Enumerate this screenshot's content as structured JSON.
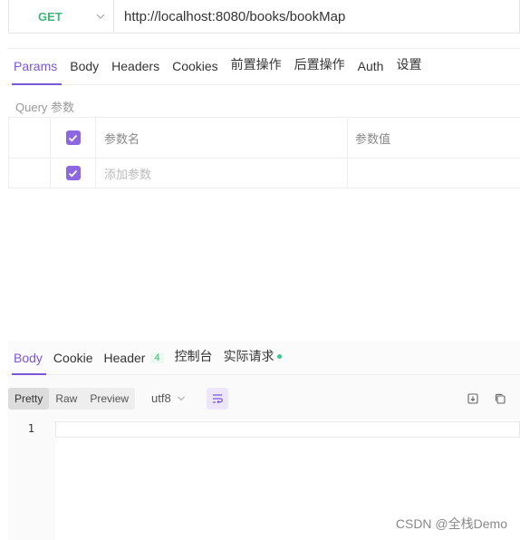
{
  "request": {
    "method": "GET",
    "url": "http://localhost:8080/books/bookMap"
  },
  "request_tabs": [
    {
      "label": "Params",
      "active": true
    },
    {
      "label": "Body"
    },
    {
      "label": "Headers"
    },
    {
      "label": "Cookies"
    },
    {
      "label": "前置操作"
    },
    {
      "label": "后置操作"
    },
    {
      "label": "Auth"
    },
    {
      "label": "设置"
    }
  ],
  "params": {
    "section_label": "Query 参数",
    "header_name": "参数名",
    "header_value": "参数值",
    "add_placeholder": "添加参数"
  },
  "response_tabs": [
    {
      "label": "Body",
      "active": true
    },
    {
      "label": "Cookie"
    },
    {
      "label": "Header",
      "badge": "4"
    },
    {
      "label": "控制台"
    },
    {
      "label": "实际请求",
      "dot": true
    }
  ],
  "view_modes": [
    "Pretty",
    "Raw",
    "Preview"
  ],
  "active_view_mode": "Pretty",
  "encoding": "utf8",
  "editor": {
    "line_number": "1"
  },
  "watermark": "CSDN @全栈Demo",
  "colors": {
    "accent": "#7b57d6",
    "method_get": "#3cb97a",
    "status_dot": "#3cc88a"
  }
}
